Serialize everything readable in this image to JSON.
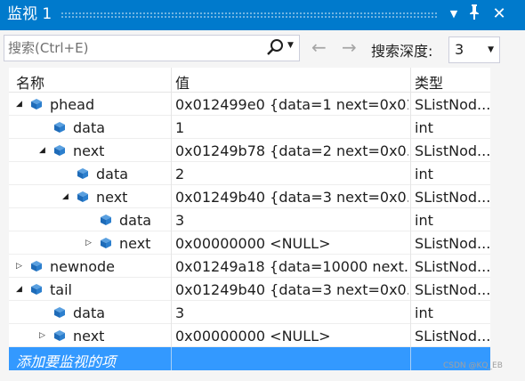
{
  "window": {
    "title": "监视 1",
    "menu_glyph": "▼",
    "pin_glyph": "ᵖ",
    "close_glyph": "✕"
  },
  "toolbar": {
    "search_placeholder": "搜索(Ctrl+E)",
    "search_dropdown_glyph": "▼",
    "back_glyph": "←",
    "forward_glyph": "→",
    "depth_label": "搜索深度:",
    "depth_value": "3",
    "depth_dropdown_glyph": "▼"
  },
  "columns": {
    "name": "名称",
    "value": "值",
    "type": "类型"
  },
  "rows": [
    {
      "name": "phead",
      "value": "0x012499e0 {data=1 next=0x01...",
      "type": "SListNod...",
      "depth": 0,
      "expander": "expanded"
    },
    {
      "name": "data",
      "value": "1",
      "type": "int",
      "depth": 1,
      "expander": "none"
    },
    {
      "name": "next",
      "value": "0x01249b78 {data=2 next=0x0...",
      "type": "SListNod...",
      "depth": 1,
      "expander": "expanded"
    },
    {
      "name": "data",
      "value": "2",
      "type": "int",
      "depth": 2,
      "expander": "none"
    },
    {
      "name": "next",
      "value": "0x01249b40 {data=3 next=0x0...",
      "type": "SListNod...",
      "depth": 2,
      "expander": "expanded"
    },
    {
      "name": "data",
      "value": "3",
      "type": "int",
      "depth": 3,
      "expander": "none"
    },
    {
      "name": "next",
      "value": "0x00000000 <NULL>",
      "type": "SListNod...",
      "depth": 3,
      "expander": "collapsed"
    },
    {
      "name": "newnode",
      "value": "0x01249a18 {data=10000 next...",
      "type": "SListNod...",
      "depth": 0,
      "expander": "collapsed"
    },
    {
      "name": "tail",
      "value": "0x01249b40 {data=3 next=0x0...",
      "type": "SListNod...",
      "depth": 0,
      "expander": "expanded"
    },
    {
      "name": "data",
      "value": "3",
      "type": "int",
      "depth": 1,
      "expander": "none"
    },
    {
      "name": "next",
      "value": "0x00000000 <NULL>",
      "type": "SListNod...",
      "depth": 1,
      "expander": "collapsed"
    }
  ],
  "add_watch": {
    "label": "添加要监视的项"
  },
  "watermark": "CSDN @KQ_EB",
  "icons": {
    "expanded_glyph": "◢",
    "collapsed_glyph": "▷",
    "variable_icon": "cube-icon"
  },
  "colors": {
    "accent": "#007acc",
    "selection": "#3399ff",
    "cube": "#1e6bb8"
  }
}
